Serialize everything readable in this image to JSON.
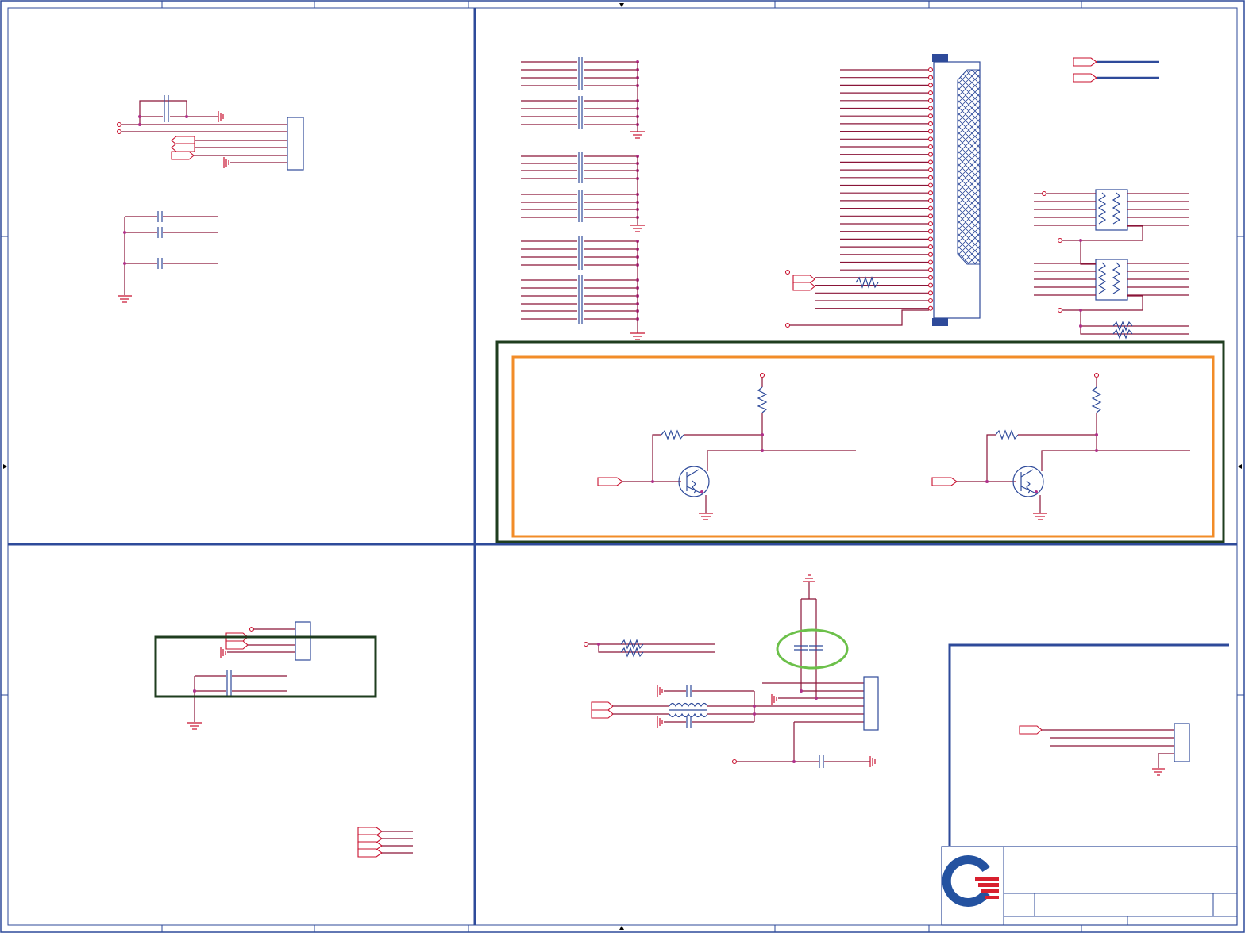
{
  "sheet": {
    "border_color": "#2e4a9a",
    "wire_color": "#8a1538",
    "component_color": "#2e4a9a",
    "port_color": "#c8102e",
    "junction_color": "#b0308a",
    "highlight_colors": {
      "dark_green_box": "#1f3d1f",
      "orange_box": "#f28c28",
      "green_ellipse": "#6cc04a"
    }
  },
  "title_block": {
    "logo_icon": "company-logo-icon",
    "title": "",
    "sheet_label": ""
  }
}
